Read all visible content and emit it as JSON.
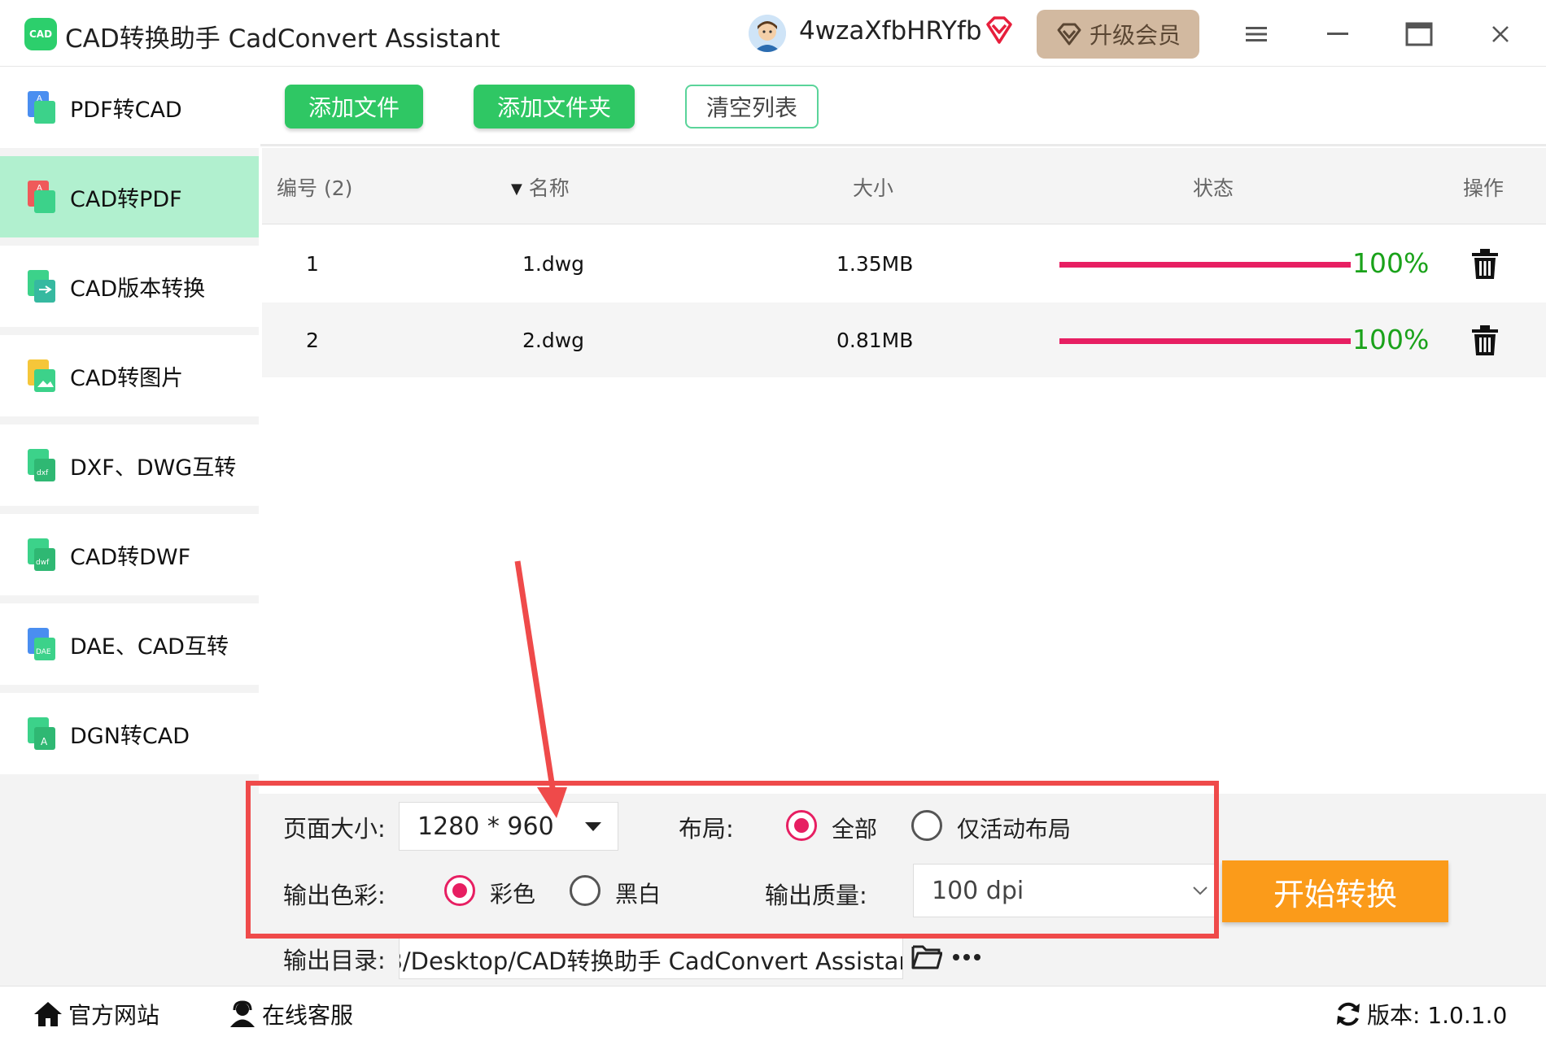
{
  "app": {
    "logo_text": "CAD",
    "title": "CAD转换助手 CadConvert Assistant",
    "username": "4wzaXfbHRYfb",
    "upgrade_label": "升级会员",
    "accent_color": "#2fc764",
    "active_color": "#b1f0cf"
  },
  "sidebar": {
    "items": [
      {
        "label": "PDF转CAD",
        "icon": "pdf-to-cad-icon",
        "active": false
      },
      {
        "label": "CAD转PDF",
        "icon": "cad-to-pdf-icon",
        "active": true
      },
      {
        "label": "CAD版本转换",
        "icon": "cad-version-icon",
        "active": false
      },
      {
        "label": "CAD转图片",
        "icon": "cad-to-image-icon",
        "active": false
      },
      {
        "label": "DXF、DWG互转",
        "icon": "dxf-dwg-icon",
        "active": false
      },
      {
        "label": "CAD转DWF",
        "icon": "cad-to-dwf-icon",
        "active": false
      },
      {
        "label": "DAE、CAD互转",
        "icon": "dae-cad-icon",
        "active": false
      },
      {
        "label": "DGN转CAD",
        "icon": "dgn-to-cad-icon",
        "active": false
      }
    ]
  },
  "toolbar": {
    "add_file": "添加文件",
    "add_folder": "添加文件夹",
    "clear_list": "清空列表"
  },
  "table": {
    "headers": {
      "number": "编号 (2)",
      "name": "名称",
      "size": "大小",
      "status": "状态",
      "action": "操作"
    },
    "rows": [
      {
        "number": "1",
        "name": "1.dwg",
        "size": "1.35MB",
        "progress": 100,
        "percent_text": "100%"
      },
      {
        "number": "2",
        "name": "2.dwg",
        "size": "0.81MB",
        "progress": 100,
        "percent_text": "100%"
      }
    ],
    "progress_color": "#e71f62",
    "percent_color": "#1aa21a"
  },
  "settings": {
    "page_size_label": "页面大小:",
    "page_size_value": "1280 * 960",
    "layout_label": "布局:",
    "layout_all": "全部",
    "layout_active": "仅活动布局",
    "color_label": "输出色彩:",
    "color_color": "彩色",
    "color_bw": "黑白",
    "quality_label": "输出质量:",
    "quality_value": "100 dpi",
    "output_dir_label": "输出目录:",
    "output_dir_value": "B/Desktop/CAD转换助手 CadConvert Assistant",
    "start_button": "开始转换",
    "start_color": "#fb9b1a"
  },
  "footer": {
    "website": "官方网站",
    "support": "在线客服",
    "version": "版本:  1.0.1.0"
  }
}
